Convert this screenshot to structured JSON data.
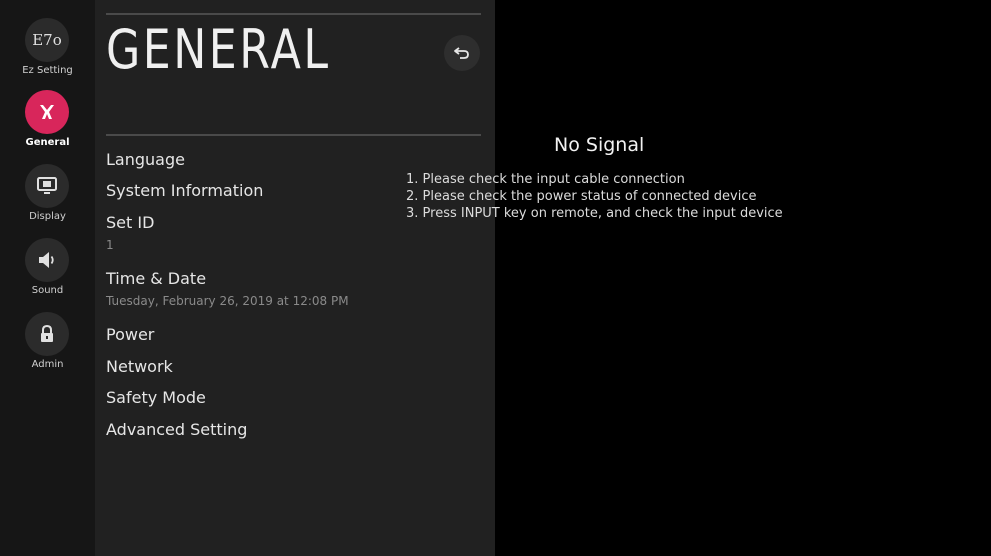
{
  "sidebar": {
    "items": [
      {
        "label": "Ez Setting",
        "icon": "ez-setting-icon",
        "icon_text": "E7o",
        "active": false
      },
      {
        "label": "General",
        "icon": "general-icon",
        "active": true
      },
      {
        "label": "Display",
        "icon": "display-icon",
        "active": false
      },
      {
        "label": "Sound",
        "icon": "sound-icon",
        "active": false
      },
      {
        "label": "Admin",
        "icon": "lock-icon",
        "active": false
      }
    ]
  },
  "panel": {
    "title": "GENERAL",
    "back_icon": "back-arrow-icon",
    "menu": [
      {
        "label": "Language"
      },
      {
        "label": "System Information"
      },
      {
        "label": "Set ID",
        "value": "1"
      },
      {
        "label": "Time & Date",
        "value": "Tuesday, February 26, 2019 at 12:08 PM"
      },
      {
        "label": "Power"
      },
      {
        "label": "Network"
      },
      {
        "label": "Safety Mode"
      },
      {
        "label": "Advanced Setting"
      }
    ]
  },
  "no_signal": {
    "title": "No Signal",
    "lines": [
      "1. Please check the input cable connection",
      "2. Please check the power status of connected device",
      "3. Press INPUT key on remote, and check the input device"
    ]
  },
  "colors": {
    "accent": "#d8265b",
    "panel_bg": "#212121",
    "rail_bg": "#161616",
    "background": "#000000"
  }
}
